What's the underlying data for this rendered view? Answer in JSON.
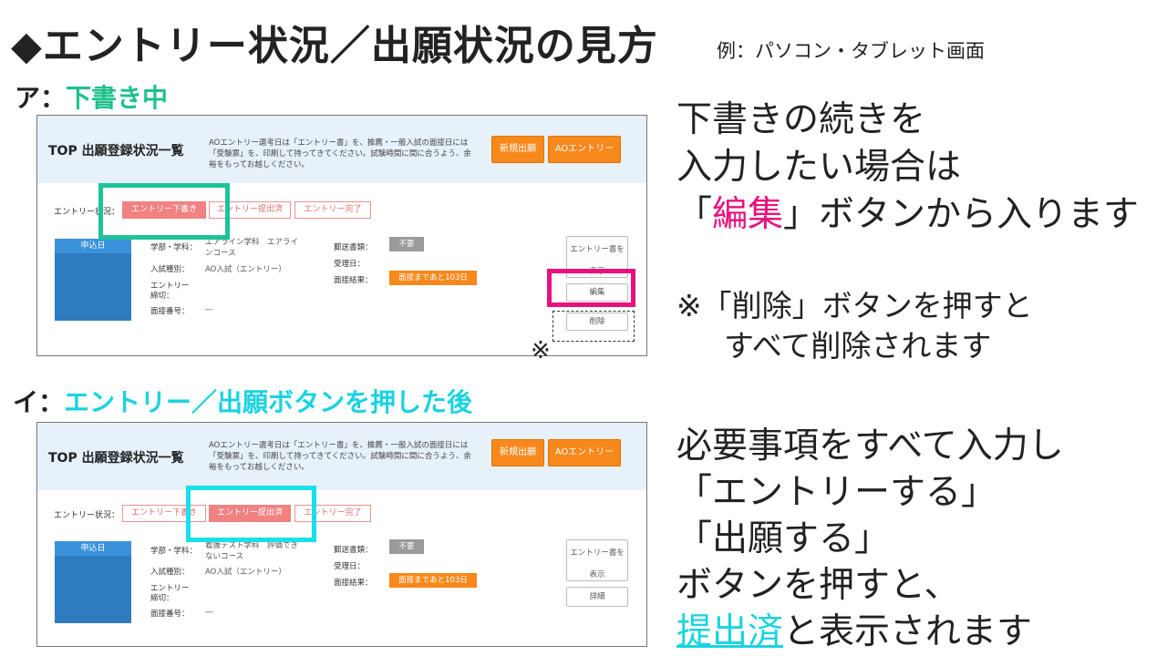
{
  "page": {
    "title": "◆エントリー状況／出願状況の見方",
    "subtitle": "例：パソコン・タブレット画面"
  },
  "colors": {
    "green": "#1ec39a",
    "pink": "#e8117f",
    "cyan": "#19e0ea",
    "orange": "#f7881b",
    "blue": "#2f7bbf"
  },
  "section_a": {
    "prefix": "ア：",
    "label": "下書き中",
    "panel": {
      "title": "TOP 出願登録状況一覧",
      "note": "AOエントリー選考日は「エントリー書」を、推薦・一般入試の面接日には「受験票」を、印刷して持ってきてください。試験時間に間に合うよう、余裕をもってお越しください。",
      "btn_new": "新規出願",
      "btn_ao": "AOエントリー",
      "status_label": "エントリー状況：",
      "steps": [
        "エントリー下書き",
        "エントリー提出済",
        "エントリー完了"
      ],
      "apply_date": "申込日",
      "faculty_key": "学部・学科：",
      "faculty_val1": "エアライン学科　エアライ",
      "faculty_val2": "ンコース",
      "exam_type_key": "入試種別：",
      "exam_type_val": "AO入試（エントリー）",
      "entry_key1": "エントリー",
      "entry_key2": "締切：",
      "interview_no_key": "面接番号：",
      "interview_no_val": "―",
      "mail_key": "郵送書類：",
      "mail_val": "不要",
      "received_key": "受理日：",
      "result_key": "面接結果：",
      "result_val": "面接まであと103日",
      "side_btn1_a": "エントリー書を",
      "side_btn1_b": "表示",
      "edit_btn": "編集",
      "delete_btn": "削除"
    },
    "kome_mark": "※",
    "right_lines": [
      "下書きの続きを",
      "入力したい場合は",
      "「",
      "編集",
      "」ボタンから入ります"
    ],
    "note_lines": [
      "※「削除」ボタンを押すと",
      "すべて削除されます"
    ]
  },
  "section_b": {
    "prefix": "イ：",
    "label": "エントリー／出願ボタンを押した後",
    "panel": {
      "title": "TOP 出願登録状況一覧",
      "note": "AOエントリー選考日は「エントリー書」を、推薦・一般入試の面接日には「受験票」を、印刷して持ってきてください。試験時間に間に合うよう、余裕をもってお越しください。",
      "btn_new": "新規出願",
      "btn_ao": "AOエントリー",
      "status_label": "エントリー状況：",
      "steps": [
        "エントリー下書き",
        "エントリー提出済",
        "エントリー完了"
      ],
      "apply_date": "申込日",
      "faculty_key": "学部・学科：",
      "faculty_val1": "看護テスト学科　評価でき",
      "faculty_val2": "ないコース",
      "exam_type_key": "入試種別：",
      "exam_type_val": "AO入試（エントリー）",
      "entry_key1": "エントリー",
      "entry_key2": "締切：",
      "interview_no_key": "面接番号：",
      "interview_no_val": "―",
      "mail_key": "郵送書類：",
      "mail_val": "不要",
      "received_key": "受理日：",
      "result_key": "面接結果：",
      "result_val": "面接まであと103日",
      "side_btn1_a": "エントリー書を",
      "side_btn1_b": "表示",
      "detail_btn": "詳細"
    },
    "right_lines": [
      "必要事項をすべて入力し",
      "「エントリーする」",
      "「出願する」",
      "ボタンを押すと、",
      "提出済",
      "と表示されます"
    ]
  }
}
